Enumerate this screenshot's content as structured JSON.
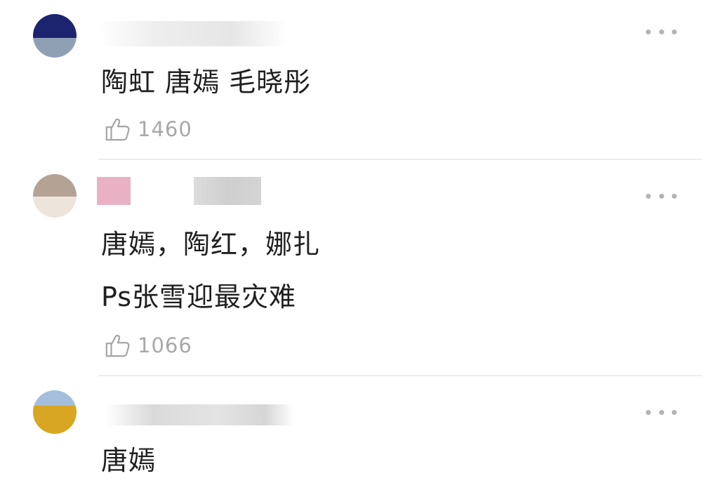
{
  "comments": [
    {
      "lines": [
        "陶虹 唐嫣 毛晓彤"
      ],
      "likes": "1460",
      "avatar_colors": [
        "#1c2470",
        "#8fa0b4"
      ],
      "name_blur_colors": [
        "#e9e9e9"
      ]
    },
    {
      "lines": [
        "唐嫣，陶红，娜扎",
        "Ps张雪迎最灾难"
      ],
      "likes": "1066",
      "avatar_colors": [
        "#b4a294",
        "#ede4dc"
      ],
      "name_blur_colors": [
        "#e8b2c4",
        "#cfcfcf"
      ]
    },
    {
      "lines": [
        "唐嫣"
      ],
      "likes": "",
      "avatar_colors": [
        "#a4bedc",
        "#d8a623"
      ],
      "name_blur_colors": [
        "#dadada"
      ]
    }
  ],
  "icons": {
    "more": "more-dots-icon",
    "like": "thumbs-up-icon"
  },
  "colors": {
    "text": "#1f1f1f",
    "like_count": "#a8a8a8",
    "divider": "#ececec",
    "more_dots": "#b3b3b3"
  }
}
